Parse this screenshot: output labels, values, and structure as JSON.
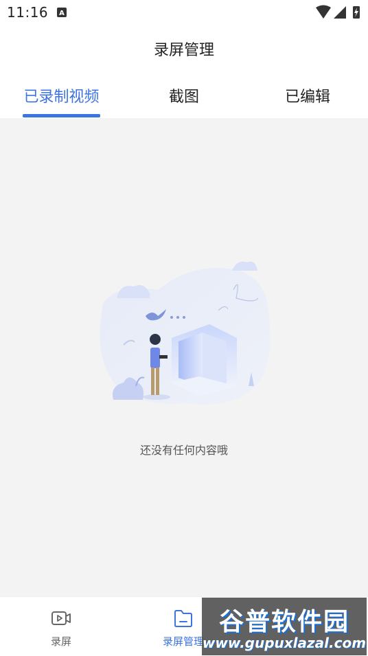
{
  "status_bar": {
    "time": "11:16",
    "notification_icon": "a-icon",
    "right_icons": [
      "wifi-icon",
      "cell-signal-icon",
      "battery-charging-icon"
    ]
  },
  "header": {
    "title": "录屏管理"
  },
  "tabs": [
    {
      "label": "已录制视频",
      "active": true
    },
    {
      "label": "截图",
      "active": false
    },
    {
      "label": "已编辑",
      "active": false
    }
  ],
  "empty_state": {
    "illustration": "empty-illustration",
    "message": "还没有任何内容哦"
  },
  "bottom_nav": [
    {
      "label": "录屏",
      "icon": "video-icon",
      "active": false
    },
    {
      "label": "录屏管理",
      "icon": "folder-icon",
      "active": true
    }
  ],
  "watermark": {
    "brand": "谷普软件园",
    "url": "www.gupuxlazal.com"
  },
  "colors": {
    "accent": "#3b73e0",
    "background": "#f3f3f3"
  }
}
